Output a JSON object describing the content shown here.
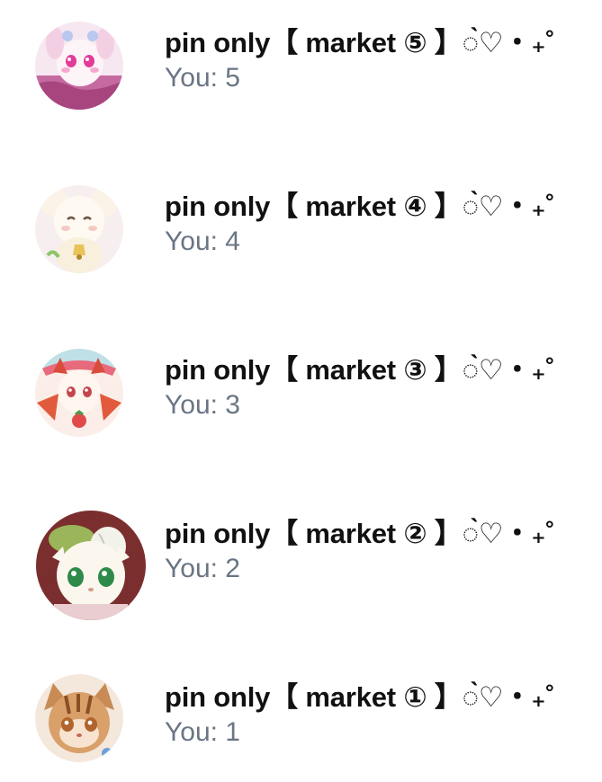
{
  "chats": [
    {
      "title": "pin only【 market ⑤ 】◌̀♡・₊˚",
      "last_message": "You: 5",
      "avatar_icon": "pink-mascot-avatar"
    },
    {
      "title": "pin only【 market ④ 】◌̀♡・₊˚",
      "last_message": "You: 4",
      "avatar_icon": "cream-lamb-mascot-avatar"
    },
    {
      "title": "pin only【 market ③ 】◌̀♡・₊˚",
      "last_message": "You: 3",
      "avatar_icon": "red-cat-mascot-avatar"
    },
    {
      "title": "pin only【 market ② 】◌̀♡・₊˚",
      "last_message": "You: 2",
      "avatar_icon": "green-hat-cat-avatar"
    },
    {
      "title": "pin only【 market ① 】◌̀♡・₊˚",
      "last_message": "You: 1",
      "avatar_icon": "brown-tabby-mascot-avatar"
    }
  ]
}
